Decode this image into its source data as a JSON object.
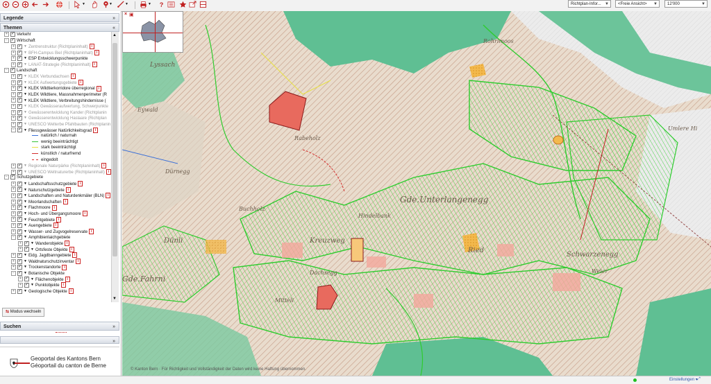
{
  "toolbar": {
    "icons": [
      "zoom-in-icon",
      "zoom-out-icon",
      "pan-icon",
      "back-icon",
      "forward-icon",
      "globe-icon",
      "select-icon",
      "hand-icon",
      "info-pin-icon",
      "measure-icon",
      "print-icon",
      "help-icon",
      "legend-list-icon",
      "favorite-star-icon",
      "share-icon",
      "layers-icon"
    ],
    "select_richtplan": "Richtplan-Infor...",
    "select_view": "<Freie Ansicht>",
    "select_scale": "12'000"
  },
  "panel": {
    "legende": "Legende",
    "themen": "Themen",
    "tree": [
      {
        "label": "Verkehr",
        "level": 0,
        "exp": "+",
        "cb": true,
        "grey": false,
        "info": false
      },
      {
        "label": "Wirtschaft",
        "level": 0,
        "exp": "−",
        "cb": true,
        "grey": false,
        "info": false
      },
      {
        "label": "Zentrenstruktur (Richtplaninhalt)",
        "level": 1,
        "exp": "+",
        "cb": true,
        "grey": true,
        "info": true
      },
      {
        "label": "BFH-Campus Biel (Richtplaninhalt)",
        "level": 1,
        "exp": "+",
        "cb": true,
        "grey": true,
        "info": true
      },
      {
        "label": "ESP Entwicklungsschwerpunkte",
        "level": 1,
        "exp": "+",
        "cb": true,
        "grey": false,
        "info": false
      },
      {
        "label": "LANAT-Strategie (Richtplaninhalt)",
        "level": 1,
        "exp": "+",
        "cb": true,
        "grey": true,
        "info": true
      },
      {
        "label": "Landschaft",
        "level": 0,
        "exp": "−",
        "cb": true,
        "grey": false,
        "info": false
      },
      {
        "label": "KLEK Verbundachsen",
        "level": 1,
        "exp": "+",
        "cb": true,
        "grey": true,
        "info": true
      },
      {
        "label": "KLEK Aufwertungsgebiete",
        "level": 1,
        "exp": "+",
        "cb": true,
        "grey": true,
        "info": true
      },
      {
        "label": "KLEK Wildtierkorridore überregional",
        "level": 1,
        "exp": "+",
        "cb": true,
        "grey": false,
        "info": true
      },
      {
        "label": "KLEK Wildtiere, Massnahmenperimeter (R",
        "level": 1,
        "exp": "+",
        "cb": true,
        "grey": false,
        "info": false
      },
      {
        "label": "KLEK Wildtiere, Verbreitungshindernisse (",
        "level": 1,
        "exp": "+",
        "cb": true,
        "grey": false,
        "info": false
      },
      {
        "label": "KLEK Gewässeraufwertung, Schwerpunkte",
        "level": 1,
        "exp": "+",
        "cb": true,
        "grey": true,
        "info": false
      },
      {
        "label": "Gewässerentwicklung Kander (Richtplanin",
        "level": 1,
        "exp": "+",
        "cb": true,
        "grey": true,
        "info": false
      },
      {
        "label": "Gewässerentwicklung Haslaare (Richtplan",
        "level": 1,
        "exp": "+",
        "cb": true,
        "grey": true,
        "info": false
      },
      {
        "label": "UNESCO Welterbe Pfahlbauten (Richtplanin",
        "level": 1,
        "exp": "+",
        "cb": true,
        "grey": true,
        "info": false
      },
      {
        "label": "Fliessgewässer Natürlichkeitsgrad",
        "level": 1,
        "exp": "−",
        "cb": true,
        "grey": false,
        "info": true
      }
    ],
    "fliess_legend": [
      {
        "label": "natürlich / naturnah",
        "color": "#3a6fd8",
        "style": "solid"
      },
      {
        "label": "wenig beeinträchtigt",
        "color": "#34c234",
        "style": "solid"
      },
      {
        "label": "stark beeinträchtigt",
        "color": "#e8e040",
        "style": "solid"
      },
      {
        "label": "künstlich / naturfremd",
        "color": "#d42a2a",
        "style": "solid"
      },
      {
        "label": "eingedolt",
        "color": "#d42a2a",
        "style": "dashed"
      }
    ],
    "tree2": [
      {
        "label": "Regionale Naturpärke (Richtplaninhalt)",
        "level": 1,
        "exp": "+",
        "cb": true,
        "grey": true,
        "info": true
      },
      {
        "label": "UNESCO Weltnaturerbe (Richtplaninhalt)",
        "level": 1,
        "exp": "+",
        "cb": true,
        "grey": true,
        "info": true
      },
      {
        "label": "Schutzgebiete",
        "level": 0,
        "exp": "−",
        "cb": true,
        "grey": false,
        "info": false
      },
      {
        "label": "Landschaftsschutzgebiete",
        "level": 1,
        "exp": "+",
        "cb": true,
        "grey": false,
        "info": true
      },
      {
        "label": "Naturschutzgebiete",
        "level": 1,
        "exp": "+",
        "cb": true,
        "grey": false,
        "info": true
      },
      {
        "label": "Landschaften und Naturdenkmäler (BLN)",
        "level": 1,
        "exp": "+",
        "cb": true,
        "grey": false,
        "info": true
      },
      {
        "label": "Moorlandschaften",
        "level": 1,
        "exp": "+",
        "cb": true,
        "grey": false,
        "info": true
      },
      {
        "label": "Flachmoore",
        "level": 1,
        "exp": "+",
        "cb": true,
        "grey": false,
        "info": true
      },
      {
        "label": "Hoch- und Übergangsmoore",
        "level": 1,
        "exp": "+",
        "cb": true,
        "grey": false,
        "info": true
      },
      {
        "label": "Feuchtgebiete",
        "level": 1,
        "exp": "+",
        "cb": true,
        "grey": false,
        "info": true
      },
      {
        "label": "Auengebiete",
        "level": 1,
        "exp": "+",
        "cb": true,
        "grey": false,
        "info": true
      },
      {
        "label": "Wasser- und Zugvogelreservate",
        "level": 1,
        "exp": "+",
        "cb": true,
        "grey": false,
        "info": true
      },
      {
        "label": "Amphibienlaichgebiete",
        "level": 1,
        "exp": "−",
        "cb": true,
        "grey": false,
        "info": false
      },
      {
        "label": "Wanderobjekte",
        "level": 2,
        "exp": "+",
        "cb": true,
        "grey": false,
        "info": true
      },
      {
        "label": "Ortsfeste Objekte",
        "level": 2,
        "exp": "+",
        "cb": true,
        "grey": false,
        "info": true
      },
      {
        "label": "Eidg. Jagdbanngebiete",
        "level": 1,
        "exp": "+",
        "cb": true,
        "grey": false,
        "info": true
      },
      {
        "label": "Waldnaturschutzinventar",
        "level": 1,
        "exp": "+",
        "cb": true,
        "grey": false,
        "info": true
      },
      {
        "label": "Trockenstandorte",
        "level": 1,
        "exp": "+",
        "cb": true,
        "grey": false,
        "info": true
      },
      {
        "label": "Botanische Objekte",
        "level": 1,
        "exp": "−",
        "cb": true,
        "grey": false,
        "info": false
      },
      {
        "label": "Flächenobjekte",
        "level": 2,
        "exp": "+",
        "cb": true,
        "grey": false,
        "info": true
      },
      {
        "label": "Punktobjekte",
        "level": 2,
        "exp": "+",
        "cb": true,
        "grey": false,
        "info": true
      },
      {
        "label": "Geologische Objekte",
        "level": 1,
        "exp": "+",
        "cb": true,
        "grey": false,
        "info": true
      }
    ],
    "modus": "Modus wechseln",
    "suchen": "Suchen",
    "brand_de": "Geoportal des Kantons Bern",
    "brand_fr": "Géoportail du canton de Berne"
  },
  "map": {
    "copyright": "© Kanton Bern · Für Richtigkeit und Vollständigkeit der Daten wird keine Haftung übernommen.",
    "places": [
      "Lyssach",
      "Eywald",
      "Buchholz",
      "Dürnegg",
      "Rabeholz",
      "Rohrimoos",
      "Hindelbank",
      "Gde.Unterlangenegg",
      "Gde.Fahrni",
      "Kreuzweg",
      "Dünli",
      "Schwarzenegg",
      "Ried",
      "Weier",
      "Dachsegg",
      "Mitteli",
      "Umlere Hi"
    ]
  },
  "status": {
    "einstellungen": "Einstellungen"
  },
  "colors": {
    "forest": "#5fbf93",
    "green_line": "#2ecc2e",
    "red_area": "#e86a5e",
    "orange_area": "#f0b24a"
  }
}
